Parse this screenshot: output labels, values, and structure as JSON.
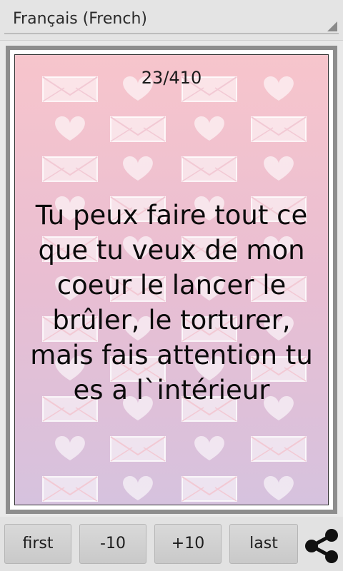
{
  "language_selector": {
    "selected": "Français (French)"
  },
  "card": {
    "counter": "23/410",
    "quote": "Tu peux faire tout ce que tu veux de mon coeur le lancer le brûler, le torturer, mais fais attention tu es a l`intérieur"
  },
  "nav": {
    "first": "first",
    "minus10": "-10",
    "plus10": "+10",
    "last": "last"
  },
  "icons": {
    "share": "share-icon",
    "heart": "heart-icon",
    "envelope": "envelope-icon",
    "dropdown": "dropdown-corner-icon"
  },
  "colors": {
    "card_top": "#f7c5cc",
    "card_bottom": "#d6c2de",
    "pattern": "#ffffff"
  }
}
